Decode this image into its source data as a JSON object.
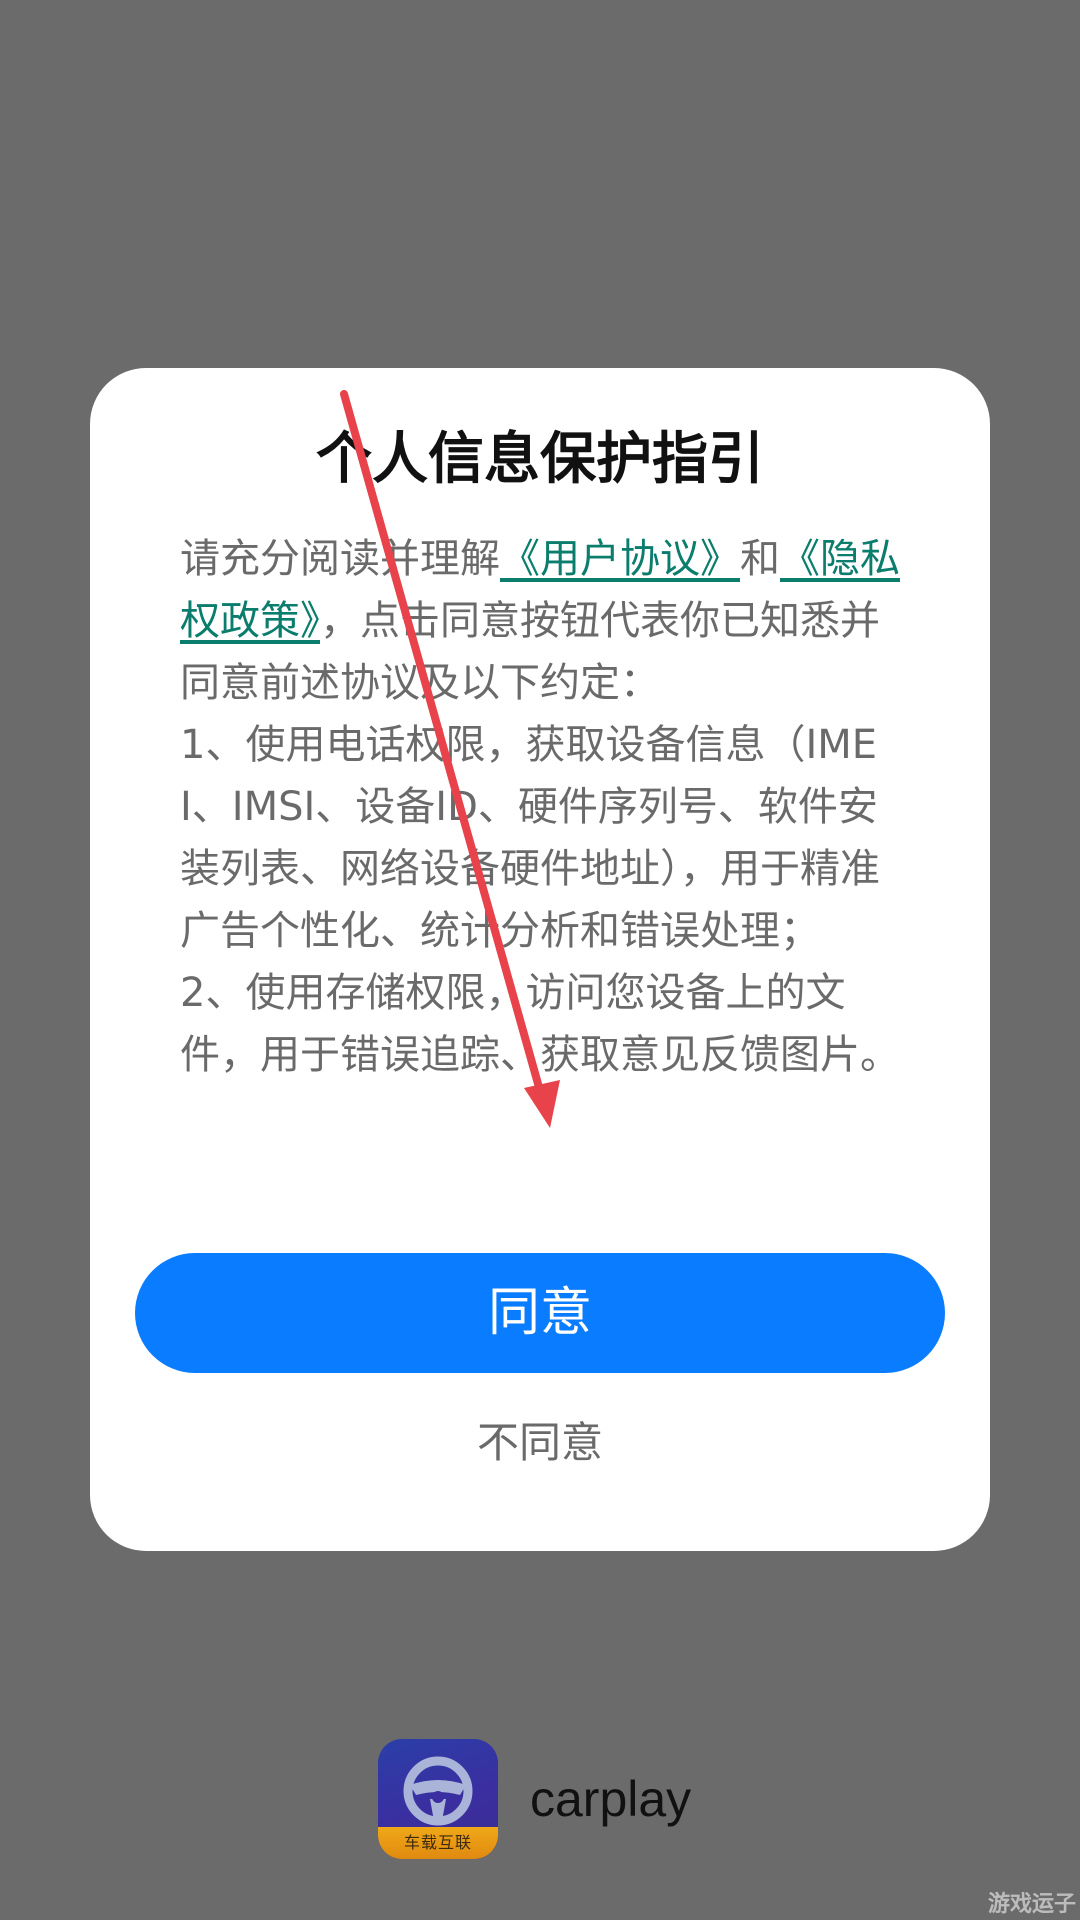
{
  "dialog": {
    "title": "个人信息保护指引",
    "body": {
      "intro_prefix": "请充分阅读并理解",
      "user_agreement_link": "《用户协议》",
      "intro_and": "和",
      "privacy_policy_link": "《隐私权政策》",
      "intro_suffix": "，点击同意按钮代表你已知悉并同意前述协议及以下约定：",
      "item_1": "1、使用电话权限，获取设备信息（IMEI、IMSI、设备ID、硬件序列号、软件安装列表、网络设备硬件地址），用于精准广告个性化、统计分析和错误处理；",
      "item_2": " 2、使用存储权限，访问您设备上的文件，用于错误追踪、获取意见反馈图片。"
    },
    "agree_label": "同意",
    "disagree_label": "不同意"
  },
  "app": {
    "name": "carplay",
    "icon_badge": "车载互联",
    "icon": "steering-wheel-icon"
  },
  "watermark": "游戏运子",
  "colors": {
    "overlay": "#6b6b6b",
    "dialog_bg": "#ffffff",
    "primary_button": "#0a7cff",
    "link": "#0a7d6c",
    "annotation_arrow": "#e8424a"
  }
}
